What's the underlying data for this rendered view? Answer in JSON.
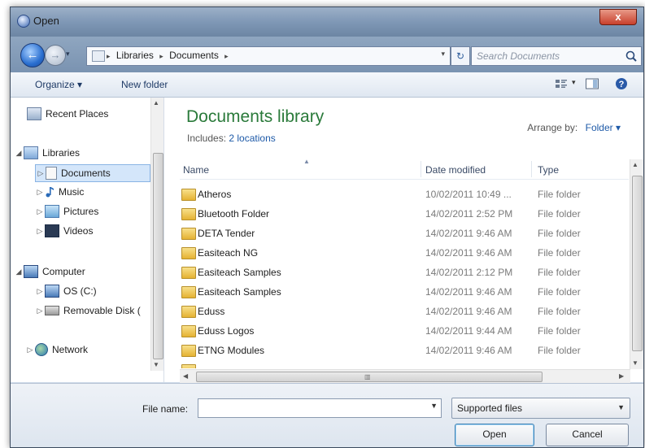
{
  "window": {
    "title": "Open",
    "close_label": "x"
  },
  "nav": {
    "back_glyph": "←",
    "forward_glyph": "→",
    "recent_glyph": "▾",
    "breadcrumbs": [
      "Libraries",
      "Documents"
    ],
    "crumb_separator": "▸",
    "refresh_glyph": "↻",
    "search_placeholder": "Search Documents"
  },
  "toolbar": {
    "organize_label": "Organize ▾",
    "new_folder_label": "New folder",
    "view_dropdown_glyph": "▾"
  },
  "sidebar": {
    "items": [
      {
        "label": "Recent Places",
        "icon": "recent-places-icon"
      },
      {
        "label": "Libraries",
        "icon": "libraries-icon",
        "expanded": true
      },
      {
        "label": "Documents",
        "icon": "documents-icon",
        "selected": true
      },
      {
        "label": "Music",
        "icon": "music-icon"
      },
      {
        "label": "Pictures",
        "icon": "pictures-icon"
      },
      {
        "label": "Videos",
        "icon": "videos-icon"
      },
      {
        "label": "Computer",
        "icon": "computer-icon",
        "expanded": true
      },
      {
        "label": "OS (C:)",
        "icon": "drive-icon"
      },
      {
        "label": "Removable Disk (",
        "icon": "removable-disk-icon"
      },
      {
        "label": "Network",
        "icon": "network-icon"
      }
    ]
  },
  "library": {
    "title": "Documents library",
    "includes_label": "Includes:",
    "includes_link": "2 locations",
    "arrange_label": "Arrange by:",
    "arrange_value": "Folder ▾"
  },
  "columns": {
    "name": "Name",
    "date": "Date modified",
    "type": "Type"
  },
  "files": [
    {
      "name": "Atheros",
      "date": "10/02/2011 10:49 ...",
      "type": "File folder"
    },
    {
      "name": "Bluetooth Folder",
      "date": "14/02/2011 2:52 PM",
      "type": "File folder"
    },
    {
      "name": "DETA Tender",
      "date": "14/02/2011 9:46 AM",
      "type": "File folder"
    },
    {
      "name": "Easiteach NG",
      "date": "14/02/2011 9:46 AM",
      "type": "File folder"
    },
    {
      "name": "Easiteach Samples",
      "date": "14/02/2011 2:12 PM",
      "type": "File folder"
    },
    {
      "name": "Easiteach Samples",
      "date": "14/02/2011 9:46 AM",
      "type": "File folder"
    },
    {
      "name": "Eduss",
      "date": "14/02/2011 9:46 AM",
      "type": "File folder"
    },
    {
      "name": "Eduss Logos",
      "date": "14/02/2011 9:44 AM",
      "type": "File folder"
    },
    {
      "name": "ETNG Modules",
      "date": "14/02/2011 9:46 AM",
      "type": "File folder"
    }
  ],
  "footer": {
    "filename_label": "File name:",
    "filename_value": "",
    "filter_value": "Supported files",
    "open_label": "Open",
    "cancel_label": "Cancel"
  }
}
